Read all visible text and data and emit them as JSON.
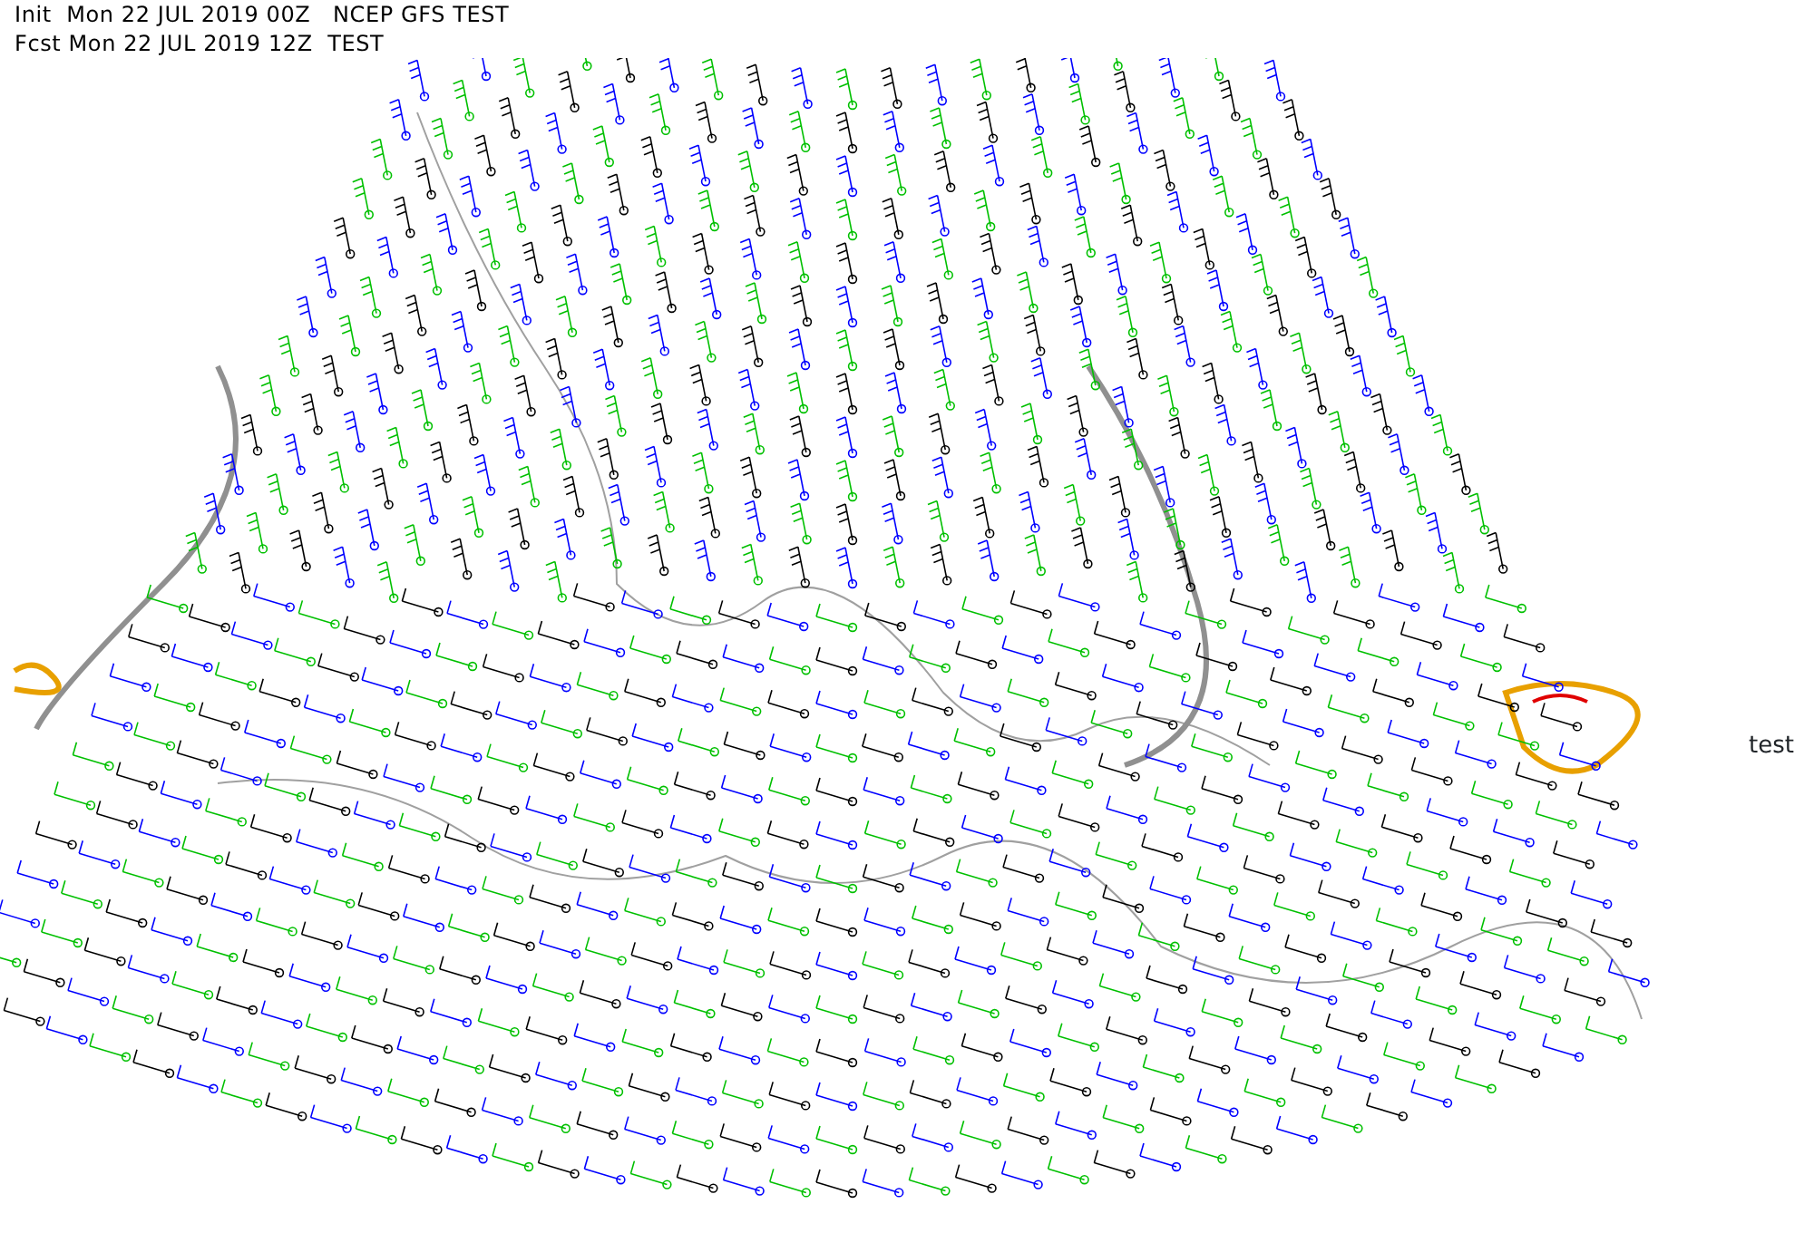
{
  "header": {
    "lines": [
      "Init  Mon 22 JUL 2019 00Z   NCEP GFS TEST",
      "Fcst Mon 22 JUL 2019 12Z  TEST"
    ]
  },
  "side_label": "test"
}
